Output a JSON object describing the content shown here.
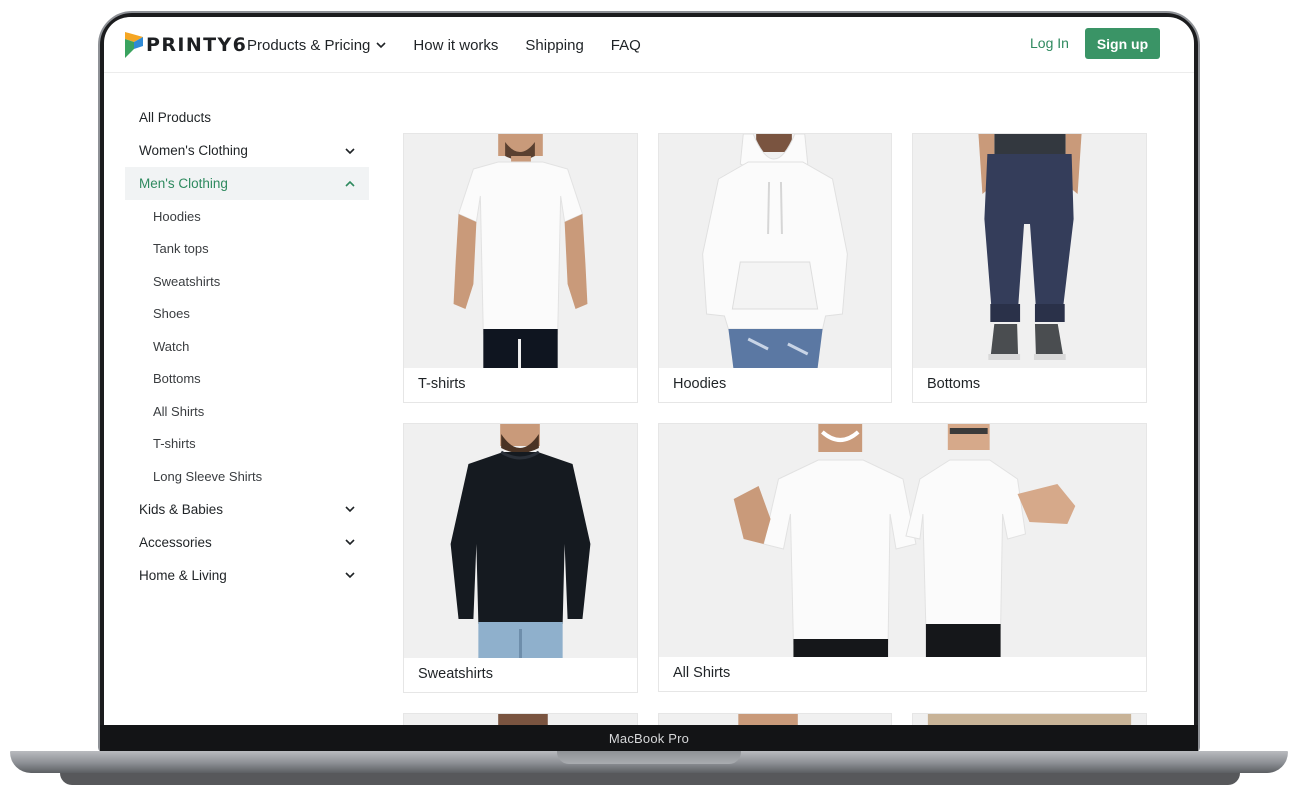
{
  "device": {
    "bezel_label": "MacBook Pro"
  },
  "brand": {
    "logo_text": "PRINTY6",
    "accent": "#3a9466",
    "logo_colors": [
      "#f5a623",
      "#2f8ad6",
      "#3aa35f"
    ]
  },
  "header": {
    "nav": [
      {
        "label": "Products & Pricing",
        "has_dropdown": true
      },
      {
        "label": "How it works"
      },
      {
        "label": "Shipping"
      },
      {
        "label": "FAQ"
      }
    ],
    "login_label": "Log In",
    "signup_label": "Sign up"
  },
  "sidebar": {
    "all_products": "All Products",
    "categories": [
      {
        "label": "Women's Clothing",
        "expanded": false
      },
      {
        "label": "Men's Clothing",
        "expanded": true,
        "children": [
          "Hoodies",
          "Tank tops",
          "Sweatshirts",
          "Shoes",
          "Watch",
          "Bottoms",
          "All Shirts",
          "T-shirts",
          "Long Sleeve Shirts"
        ]
      },
      {
        "label": "Kids & Babies",
        "expanded": false
      },
      {
        "label": "Accessories",
        "expanded": false
      },
      {
        "label": "Home & Living",
        "expanded": false
      }
    ]
  },
  "products": [
    {
      "label": "T-shirts",
      "image": "man-white-tshirt"
    },
    {
      "label": "Hoodies",
      "image": "man-white-hoodie"
    },
    {
      "label": "Bottoms",
      "image": "navy-jogger-pants"
    },
    {
      "label": "Sweatshirts",
      "image": "man-black-sweatshirt"
    },
    {
      "label": "All Shirts",
      "image": "couple-white-tshirts"
    }
  ]
}
